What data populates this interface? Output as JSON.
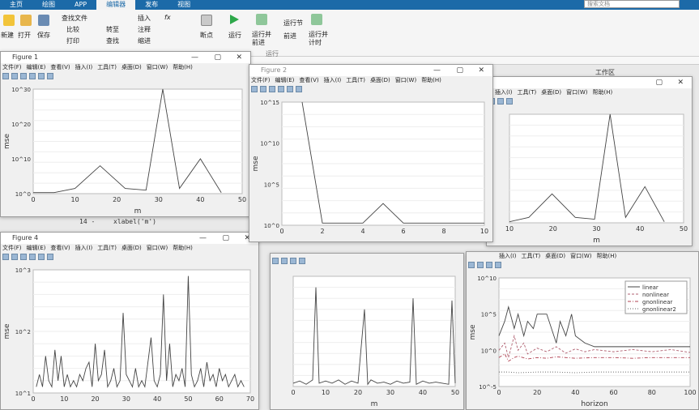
{
  "tabs": [
    "主页",
    "绘图",
    "APP",
    "编辑器",
    "发布",
    "视图"
  ],
  "active_tab": 3,
  "search_placeholder": "搜索文档",
  "ribbon": {
    "new": "新建",
    "open": "打开",
    "save": "保存",
    "find_file": "查找文件",
    "compare": "比较",
    "print": "打印",
    "goto": "转至",
    "find": "查找",
    "insert": "插入",
    "fx": "fx",
    "comment": "注释",
    "indent": "缩进",
    "breakpoint": "断点",
    "run": "运行",
    "run_advance": "运行并\n前进",
    "run_section": "运行节",
    "advance": "前进",
    "run_time": "运行并\n计时",
    "run_group": "运行"
  },
  "workspace_label": "工作区",
  "code_line": {
    "num": "14 -",
    "text": "xlabel('m')"
  },
  "menu": [
    "文件(F)",
    "编辑(E)",
    "查看(V)",
    "插入(I)",
    "工具(T)",
    "桌面(D)",
    "窗口(W)",
    "帮助(H)"
  ],
  "figures": {
    "f1": {
      "title": "Figure 1"
    },
    "f2": {
      "title": "Figure 2"
    },
    "f4": {
      "title": "Figure 4"
    }
  },
  "chart_data": [
    {
      "id": "fig1",
      "type": "line",
      "xlabel": "m",
      "ylabel": "mse",
      "yscale": "log",
      "xticks": [
        "0",
        "10",
        "20",
        "30",
        "40",
        "50"
      ],
      "yticks": [
        "10^0",
        "10^10",
        "10^20",
        "10^30"
      ],
      "xlim": [
        0,
        50
      ],
      "ylim": [
        0,
        30
      ],
      "x": [
        0,
        5,
        10,
        16,
        22,
        27,
        31,
        35,
        40,
        45
      ],
      "y": [
        0.3,
        0.3,
        1.5,
        8,
        1.5,
        1,
        36,
        1.5,
        10,
        0.3
      ]
    },
    {
      "id": "fig2",
      "type": "line",
      "xlabel": "",
      "ylabel": "mse",
      "yscale": "log",
      "xticks": [
        "0",
        "2",
        "4",
        "6",
        "8",
        "10"
      ],
      "yticks": [
        "10^0",
        "10^5",
        "10^10",
        "10^15"
      ],
      "xlim": [
        0,
        10
      ],
      "ylim": [
        0,
        17
      ],
      "x": [
        1,
        2,
        3,
        4,
        5,
        6,
        7,
        8,
        9,
        10
      ],
      "y": [
        18,
        0.3,
        0.3,
        0.3,
        3,
        0.3,
        0.3,
        0.3,
        0.3,
        0.3
      ]
    },
    {
      "id": "fig3",
      "type": "line",
      "xlabel": "m",
      "ylabel": "",
      "yscale": "log",
      "xticks": [
        "10",
        "20",
        "30",
        "40",
        "50"
      ],
      "yticks": [],
      "xlim": [
        5,
        50
      ],
      "ylim": [
        0,
        30
      ],
      "x": [
        5,
        10,
        16,
        22,
        27,
        31,
        35,
        40,
        45
      ],
      "y": [
        0.3,
        1.5,
        8,
        1.5,
        1,
        36,
        1.5,
        10,
        0.3
      ]
    },
    {
      "id": "fig4",
      "type": "line",
      "xlabel": "",
      "ylabel": "mse",
      "yscale": "log",
      "xticks": [
        "0",
        "10",
        "20",
        "30",
        "40",
        "50",
        "60",
        "70"
      ],
      "yticks": [
        "10^1",
        "10^2",
        "10^3"
      ],
      "xlim": [
        0,
        70
      ],
      "ylim": [
        1,
        3
      ],
      "x": [
        1,
        2,
        3,
        4,
        5,
        6,
        7,
        8,
        9,
        10,
        11,
        12,
        13,
        14,
        15,
        16,
        17,
        18,
        19,
        20,
        21,
        22,
        23,
        24,
        25,
        26,
        27,
        28,
        29,
        30,
        31,
        32,
        33,
        34,
        35,
        36,
        37,
        38,
        39,
        40,
        41,
        42,
        43,
        44,
        45,
        46,
        47,
        48,
        49,
        50,
        51,
        52,
        53,
        54,
        55,
        56,
        57,
        58,
        59,
        60,
        61,
        62,
        63,
        64,
        65,
        66,
        67,
        68
      ],
      "y": [
        1.1,
        1.3,
        1.1,
        1.6,
        1.2,
        1.1,
        1.7,
        1.2,
        1.6,
        1.1,
        1.3,
        1.1,
        1.2,
        1.1,
        1.3,
        1.2,
        1.4,
        1.5,
        1.1,
        1.8,
        1.2,
        1.3,
        1.7,
        1.1,
        1.2,
        1.4,
        1.1,
        1.2,
        2.3,
        1.3,
        1.2,
        1.1,
        1.4,
        1.1,
        1.2,
        1.1,
        1.5,
        1.9,
        1.2,
        1.1,
        1.3,
        2.6,
        1.2,
        1.8,
        1.1,
        1.3,
        1.2,
        1.4,
        1.1,
        2.9,
        1.3,
        1.1,
        1.2,
        1.4,
        1.1,
        1.5,
        1.2,
        1.3,
        1.1,
        1.4,
        1.2,
        1.3,
        1.1,
        1.2,
        1.3,
        1.1,
        1.2,
        1.1
      ]
    },
    {
      "id": "fig5",
      "type": "line",
      "xlabel": "m",
      "ylabel": "",
      "yscale": "log",
      "xticks": [
        "0",
        "10",
        "20",
        "30",
        "40",
        "50"
      ],
      "yticks": [],
      "xlim": [
        0,
        50
      ],
      "ylim": [
        0,
        10
      ],
      "x": [
        0,
        2,
        4,
        6,
        7,
        8,
        10,
        12,
        14,
        16,
        18,
        20,
        22,
        23,
        24,
        26,
        28,
        30,
        32,
        34,
        36,
        37,
        38,
        40,
        42,
        44,
        46,
        48,
        49,
        50
      ],
      "y": [
        0.3,
        0.5,
        0.2,
        0.6,
        9,
        0.3,
        0.5,
        0.3,
        0.6,
        0.2,
        0.5,
        0.3,
        7,
        0.2,
        0.6,
        0.3,
        0.4,
        0.2,
        0.5,
        0.3,
        0.4,
        8,
        0.2,
        0.5,
        0.3,
        0.4,
        0.3,
        0.2,
        7.8,
        0.3
      ]
    },
    {
      "id": "fig6",
      "type": "line",
      "xlabel": "horizon",
      "ylabel": "mse",
      "yscale": "log",
      "xticks": [
        "0",
        "20",
        "40",
        "60",
        "80",
        "100"
      ],
      "yticks": [
        "10^-5",
        "10^0",
        "10^5",
        "10^10"
      ],
      "xlim": [
        0,
        100
      ],
      "ylim": [
        -5,
        10
      ],
      "legend": [
        "linear",
        "nonlinear",
        "gnonlinear",
        "gnonlinear2"
      ],
      "legend_loc": "top-right",
      "series": [
        {
          "name": "linear",
          "x": [
            0,
            3,
            5,
            8,
            10,
            13,
            15,
            18,
            20,
            25,
            30,
            32,
            35,
            38,
            40,
            45,
            50,
            60,
            70,
            80,
            90,
            100
          ],
          "y": [
            2,
            4,
            6,
            3,
            5,
            2,
            4,
            3,
            5,
            5,
            1,
            4,
            2,
            5,
            2,
            1,
            0.5,
            0.5,
            0.5,
            0.5,
            0.5,
            0.5
          ]
        },
        {
          "name": "nonlinear",
          "x": [
            0,
            3,
            5,
            8,
            10,
            13,
            15,
            20,
            25,
            30,
            35,
            40,
            45,
            50,
            60,
            70,
            80,
            90,
            100
          ],
          "y": [
            0,
            1,
            -1,
            2,
            0,
            1,
            -0.5,
            0.3,
            -0.2,
            0.5,
            -0.4,
            0.2,
            -0.2,
            0.1,
            -0.2,
            0.1,
            -0.2,
            0.1,
            -0.3
          ]
        },
        {
          "name": "gnonlinear",
          "x": [
            0,
            3,
            5,
            8,
            10,
            15,
            20,
            25,
            30,
            35,
            40,
            50,
            60,
            70,
            80,
            90,
            100
          ],
          "y": [
            -1,
            -0.5,
            -1.5,
            -1,
            -0.8,
            -1.2,
            -1,
            -1.1,
            -0.9,
            -1,
            -1.1,
            -1,
            -1,
            -1.1,
            -1,
            -1,
            -1
          ]
        },
        {
          "name": "gnonlinear2",
          "x": [
            0,
            5,
            10,
            20,
            30,
            40,
            50,
            60,
            70,
            80,
            90,
            100
          ],
          "y": [
            -3,
            -3,
            -3.1,
            -3,
            -3,
            -3.1,
            -3,
            -3,
            -3,
            -3,
            -3,
            -3
          ]
        }
      ]
    }
  ]
}
